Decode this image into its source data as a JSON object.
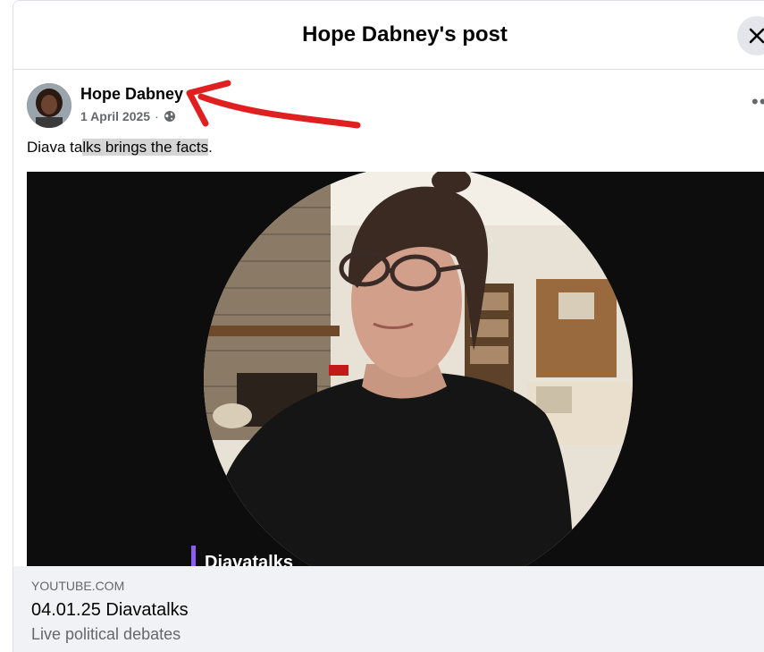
{
  "dialog": {
    "title": "Hope Dabney's post"
  },
  "post": {
    "author": "Hope Dabney",
    "date": "1 April 2025",
    "separator": "·",
    "privacy_icon": "globe-icon",
    "text_part1": "Diava ta",
    "text_highlight": "lks brings the facts",
    "text_part2": ".",
    "more_icon": "ellipsis-icon",
    "more_label": "•••"
  },
  "media": {
    "overlay_caption": "Diavatalks"
  },
  "link_preview": {
    "domain": "YOUTUBE.COM",
    "title": "04.01.25 Diavatalks",
    "description": "Live political debates"
  },
  "colors": {
    "annotation_arrow": "#e02020",
    "header_text": "#050505",
    "secondary_text": "#65676b",
    "card_bg": "#f0f2f5"
  }
}
